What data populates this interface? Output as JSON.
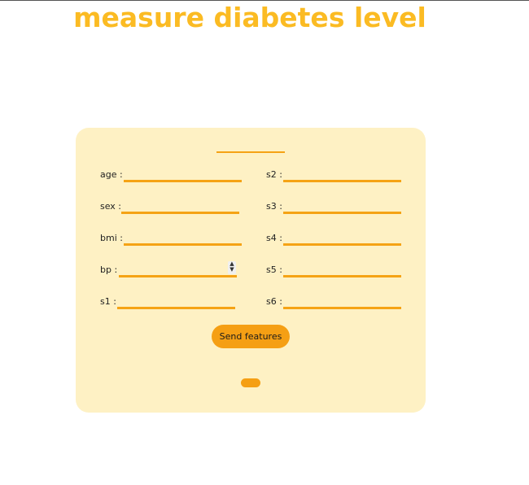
{
  "title": "measure diabetes level",
  "form": {
    "fields": [
      {
        "label": "age :",
        "value": ""
      },
      {
        "label": "sex :",
        "value": ""
      },
      {
        "label": "bmi :",
        "value": ""
      },
      {
        "label": "bp :",
        "value": ""
      },
      {
        "label": "s1 :",
        "value": ""
      },
      {
        "label": "s2 :",
        "value": ""
      },
      {
        "label": "s3 :",
        "value": ""
      },
      {
        "label": "s4 :",
        "value": ""
      },
      {
        "label": "s5 :",
        "value": ""
      },
      {
        "label": "s6 :",
        "value": ""
      }
    ],
    "submit_label": "Send features",
    "result": ""
  },
  "colors": {
    "title": "#fbbb23",
    "card_background": "#fef1c4",
    "accent": "#f5a315"
  }
}
